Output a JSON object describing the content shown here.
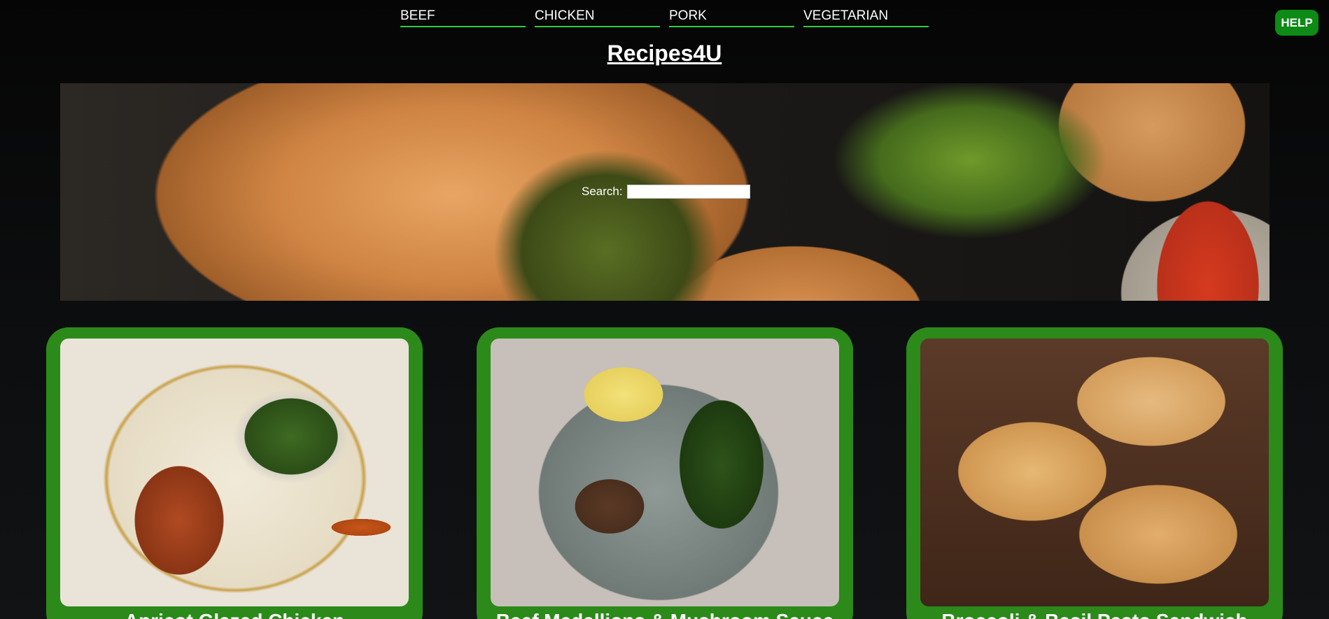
{
  "nav": {
    "items": [
      {
        "label": "BEEF"
      },
      {
        "label": "CHICKEN"
      },
      {
        "label": "PORK"
      },
      {
        "label": "VEGETARIAN"
      }
    ],
    "help_label": "HELP"
  },
  "site_title": "Recipes4U",
  "hero": {
    "search_label": "Search:",
    "search_value": ""
  },
  "cards": [
    {
      "name": "Apricot Glazed Chicken"
    },
    {
      "name": "Beef Medallions & Mushroom Sauce"
    },
    {
      "name": "Broccoli & Basil Pesto Sandwich"
    }
  ],
  "colors": {
    "accent_green": "#2ecc40",
    "card_green": "#2b8a1a",
    "help_green": "#0e8a16",
    "background": "#0b0c0d"
  }
}
